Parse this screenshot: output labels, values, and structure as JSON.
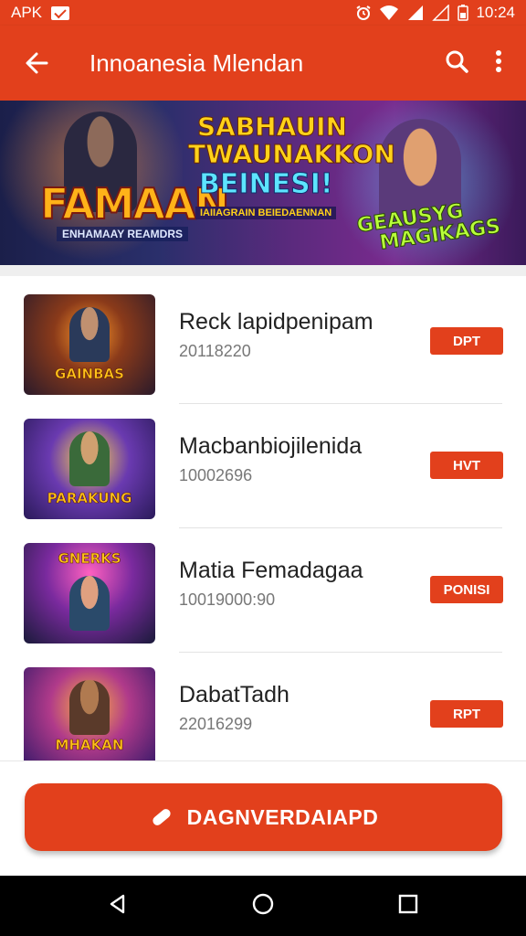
{
  "status_bar": {
    "left_text": "APK",
    "time": "10:24"
  },
  "app_bar": {
    "title": "Innoanesia Mlendan"
  },
  "banner": {
    "left_title": "FAMAAN",
    "left_subtitle": "ENHAMAAY REAMDRS",
    "center_line1": "SABHAUIN",
    "center_line2": "TWAUNAKKON",
    "center_line3": "BEINESI!",
    "center_subtitle": "IAIIAGRAIN BEIEDAENNAN",
    "right_title_line1": "GEAUSYG",
    "right_title_line2": "MAGIKAGS"
  },
  "games": [
    {
      "name": "Reck lapidpenipam",
      "number": "20118220",
      "badge": "DPT",
      "thumb_text": "GAINBAS"
    },
    {
      "name": "Macbanbiojilenida",
      "number": "10002696",
      "badge": "HVT",
      "thumb_text": "PARAKUNG"
    },
    {
      "name": "Matia Femadagaa",
      "number": "10019000:90",
      "badge": "PONISI",
      "thumb_text": "GNERKS"
    },
    {
      "name": "DabatTadh",
      "number": "22016299",
      "badge": "RPT",
      "thumb_text": "MHAKAN"
    }
  ],
  "download_button": {
    "label": "DAGNVERDAIAPD"
  },
  "colors": {
    "primary": "#e2401c",
    "nav_bar": "#000000"
  }
}
